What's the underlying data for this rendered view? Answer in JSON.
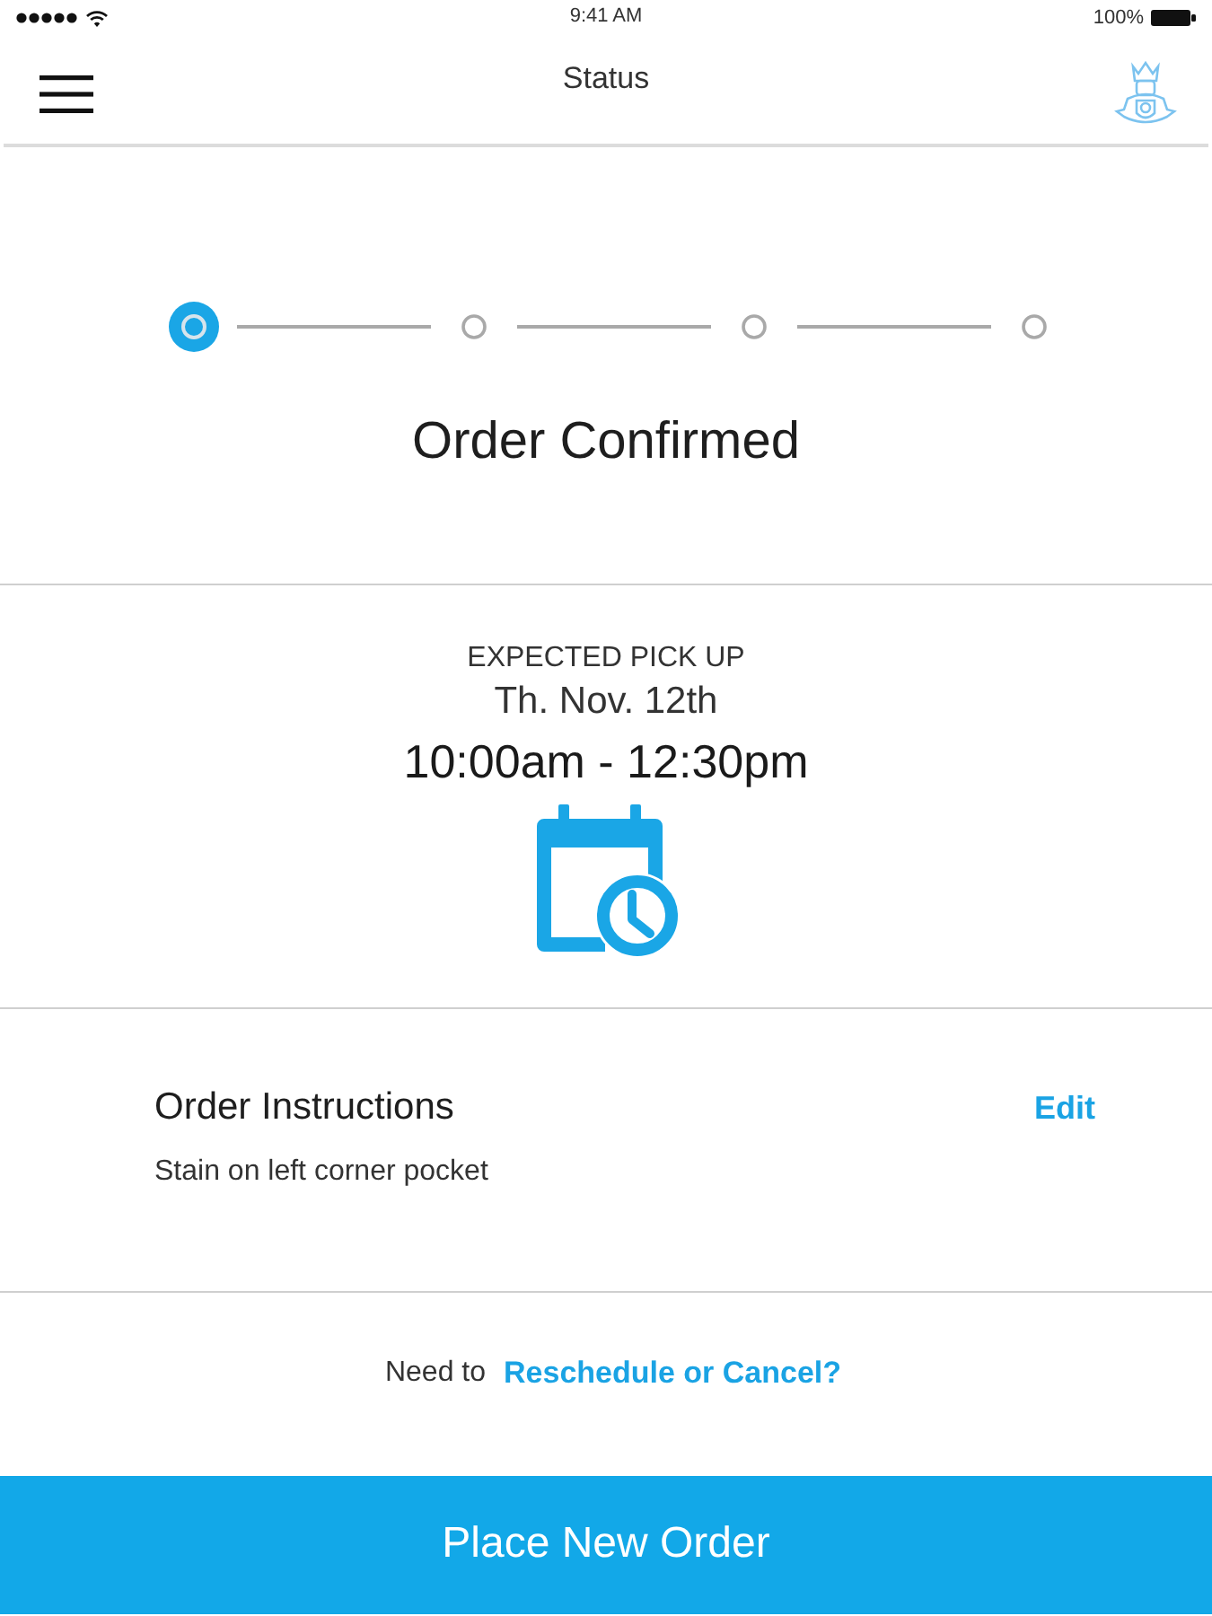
{
  "status_bar": {
    "time": "9:41 AM",
    "battery": "100%"
  },
  "nav_bar": {
    "title": "Status"
  },
  "progress": {
    "steps": [
      {
        "current": true
      },
      {
        "current": false
      },
      {
        "current": false
      },
      {
        "current": false
      }
    ],
    "status": "Order Confirmed"
  },
  "pickup": {
    "label": "EXPECTED PICK UP",
    "date": "Th. Nov. 12th",
    "time_window": "10:00am - 12:30pm"
  },
  "instructions": {
    "title": "Order Instructions",
    "action": "Edit",
    "text": "Stain on left corner pocket"
  },
  "reschedule": {
    "prompt": "Need to",
    "link": "Reschedule or Cancel?"
  },
  "primary_button": {
    "label": "Place New Order"
  }
}
